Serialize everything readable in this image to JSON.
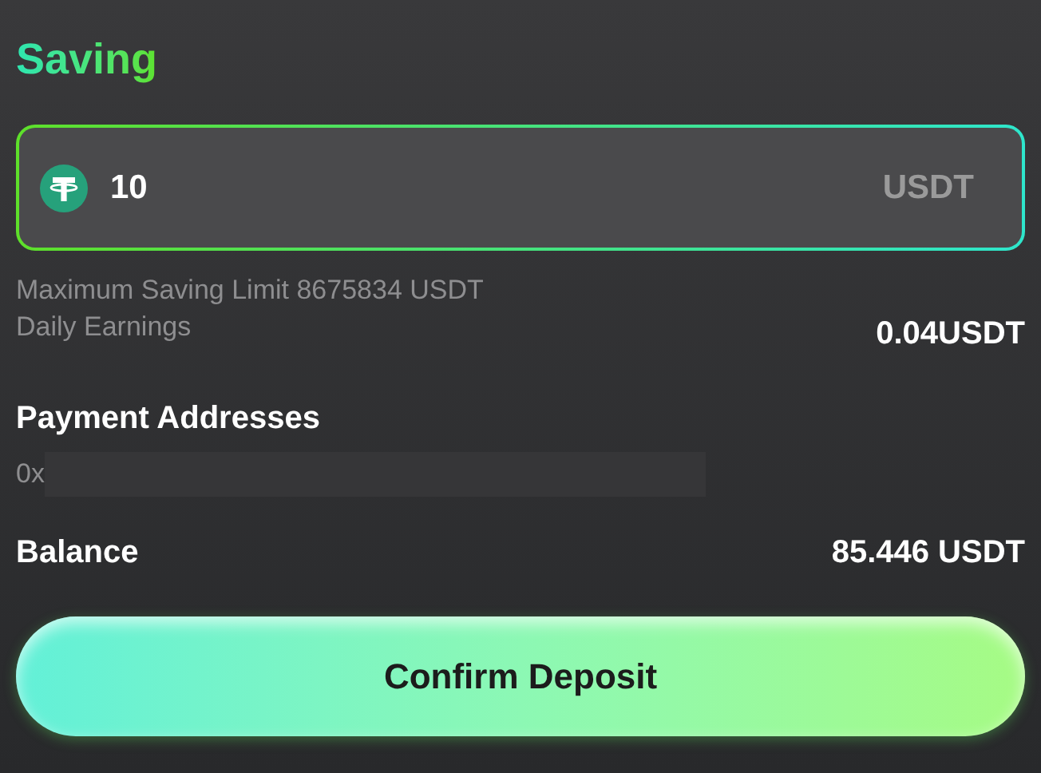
{
  "title": "Saving",
  "amount_field": {
    "value": "10",
    "unit": "USDT"
  },
  "limit_text": "Maximum Saving Limit 8675834 USDT",
  "daily_earnings": {
    "label": "Daily Earnings",
    "value": "0.04USDT"
  },
  "payment_addresses": {
    "heading": "Payment Addresses",
    "address": "0x"
  },
  "balance": {
    "label": "Balance",
    "value": "85.446 USDT"
  },
  "confirm_button": "Confirm Deposit"
}
